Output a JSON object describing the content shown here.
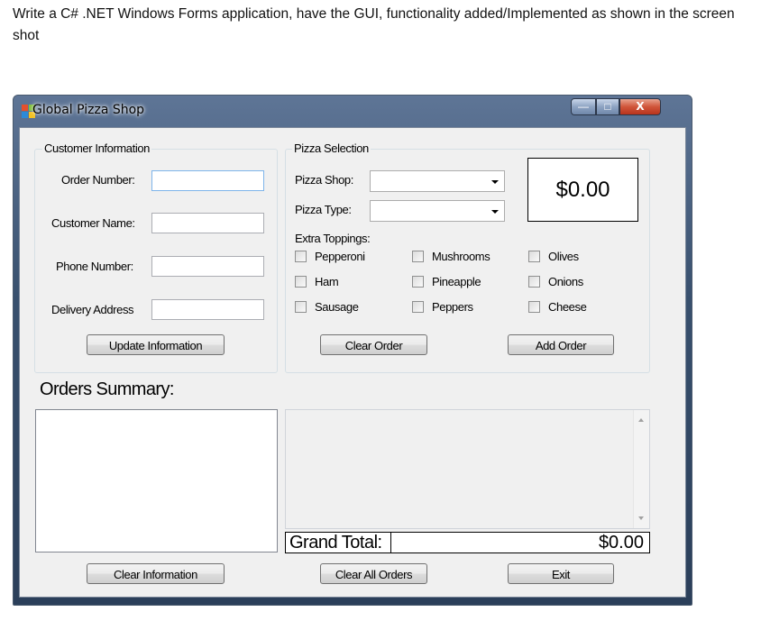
{
  "prompt": {
    "text": "Write a C# .NET Windows Forms application, have the GUI, functionality added/Implemented as shown in the screen shot"
  },
  "window": {
    "title": "Global Pizza Shop",
    "minimize_glyph": "—",
    "maximize_glyph": "□",
    "close_glyph": "X"
  },
  "customer": {
    "group_label": "Customer Information",
    "order_number_label": "Order Number:",
    "order_number_value": "",
    "customer_name_label": "Customer Name:",
    "customer_name_value": "",
    "phone_label": "Phone Number:",
    "phone_value": "",
    "address_label": "Delivery Address",
    "address_value": "",
    "update_button": "Update Information"
  },
  "pizza": {
    "group_label": "Pizza Selection",
    "shop_label": "Pizza Shop:",
    "shop_value": "",
    "type_label": "Pizza Type:",
    "type_value": "",
    "price": "$0.00",
    "toppings_label": "Extra Toppings:",
    "toppings": [
      {
        "label": "Pepperoni",
        "checked": false
      },
      {
        "label": "Mushrooms",
        "checked": false
      },
      {
        "label": "Olives",
        "checked": false
      },
      {
        "label": "Ham",
        "checked": false
      },
      {
        "label": "Pineapple",
        "checked": false
      },
      {
        "label": "Onions",
        "checked": false
      },
      {
        "label": "Sausage",
        "checked": false
      },
      {
        "label": "Peppers",
        "checked": false
      },
      {
        "label": "Cheese",
        "checked": false
      }
    ],
    "clear_order_button": "Clear Order",
    "add_order_button": "Add Order"
  },
  "summary": {
    "title": "Orders Summary:",
    "grand_total_label": "Grand Total:",
    "grand_total_value": "$0.00"
  },
  "footer": {
    "clear_info_button": "Clear Information",
    "clear_all_button": "Clear All Orders",
    "exit_button": "Exit"
  },
  "colors": {
    "form_background": "#f0f0f0",
    "title_bar": "#38506e",
    "close_button": "#d0553a"
  }
}
